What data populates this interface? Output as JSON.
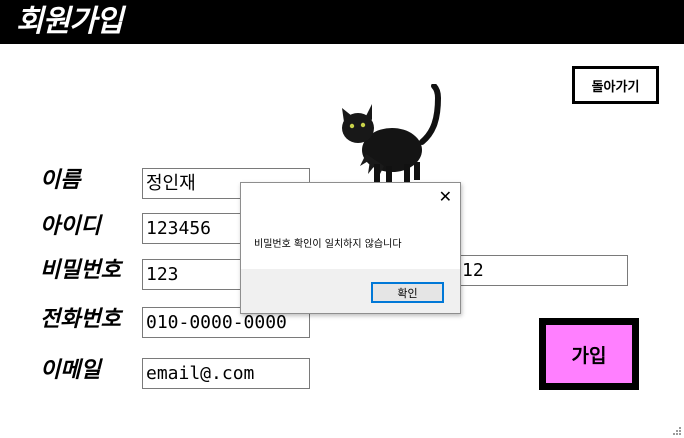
{
  "header": {
    "title": "회원가입"
  },
  "back_button": {
    "label": "돌아가기"
  },
  "image": {
    "icon": "black-cat"
  },
  "form": {
    "name": {
      "label": "이름",
      "value": "정인재"
    },
    "id": {
      "label": "아이디",
      "value": "123456"
    },
    "password": {
      "label": "비밀번호",
      "value": "123"
    },
    "password_confirm": {
      "value": "12"
    },
    "phone": {
      "label": "전화번호",
      "value": "010-0000-0000"
    },
    "email": {
      "label": "이메일",
      "value": "email@.com"
    }
  },
  "join_button": {
    "label": "가입",
    "color": "#ff7fff"
  },
  "dialog": {
    "message": "비밀번호 확인이 일치하지 않습니다",
    "ok_label": "확인",
    "close_symbol": "✕"
  }
}
